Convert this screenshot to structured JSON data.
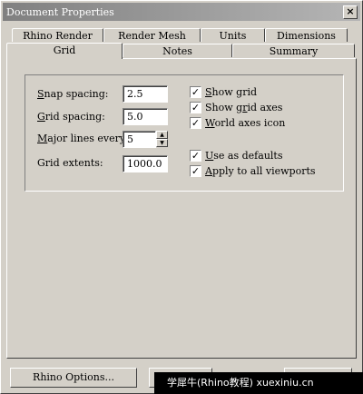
{
  "window": {
    "title": "Document Properties",
    "close": "×"
  },
  "tabs": {
    "row1": [
      "Rhino Render",
      "Render Mesh",
      "Units",
      "Dimensions"
    ],
    "row2": [
      "Grid",
      "Notes",
      "Summary"
    ]
  },
  "grid": {
    "snap_spacing": {
      "label_u": "S",
      "label_rest": "nap spacing:",
      "value": "2.5"
    },
    "grid_spacing": {
      "label_u": "G",
      "label_rest": "rid spacing:",
      "value": "5.0"
    },
    "major_lines": {
      "label_u": "M",
      "label_rest": "ajor lines every:",
      "value": "5"
    },
    "grid_extents": {
      "label": "Grid extents:",
      "value": "1000.0"
    },
    "options": [
      {
        "pre": "",
        "u": "S",
        "post": "how grid",
        "checked": true
      },
      {
        "pre": "Show g",
        "u": "r",
        "post": "id axes",
        "checked": true
      },
      {
        "pre": "",
        "u": "W",
        "post": "orld axes icon",
        "checked": true
      },
      {
        "pre": "",
        "u": "U",
        "post": "se as defaults",
        "checked": true
      },
      {
        "pre": "",
        "u": "A",
        "post": "pply to all viewports",
        "checked": true
      }
    ]
  },
  "buttons": {
    "rhino_options": "Rhino Options..."
  },
  "watermark": "学犀牛(Rhino教程)  xuexiniu.cn"
}
